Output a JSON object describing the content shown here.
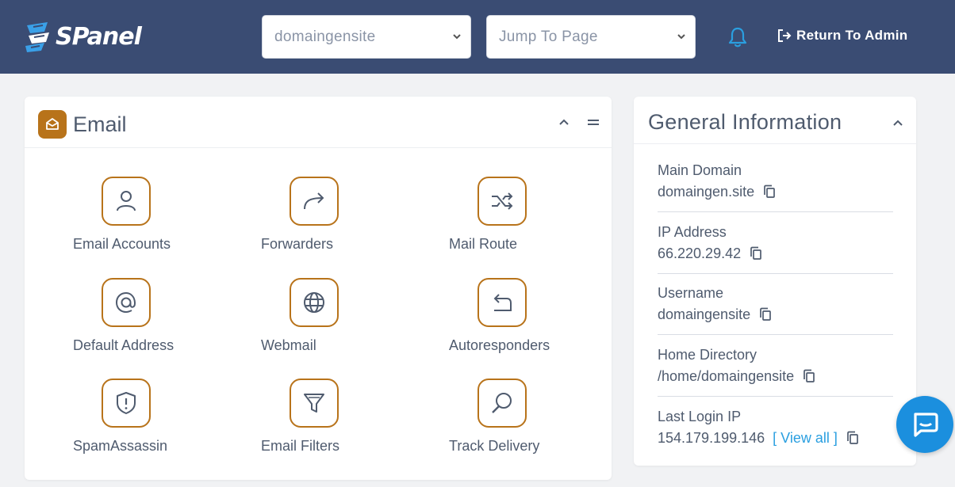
{
  "header": {
    "logo_text": "SPanel",
    "domain_select": "domaingensite",
    "jump_select": "Jump To Page",
    "return_label": "Return To Admin"
  },
  "email": {
    "title": "Email",
    "items": [
      {
        "label": "Email Accounts",
        "icon": "user-icon"
      },
      {
        "label": "Forwarders",
        "icon": "forward-arrow-icon"
      },
      {
        "label": "Mail Route",
        "icon": "shuffle-icon"
      },
      {
        "label": "Default Address",
        "icon": "at-sign-icon"
      },
      {
        "label": "Webmail",
        "icon": "globe-icon"
      },
      {
        "label": "Autoresponders",
        "icon": "reply-arrow-icon"
      },
      {
        "label": "SpamAssassin",
        "icon": "shield-alert-icon"
      },
      {
        "label": "Email Filters",
        "icon": "filter-icon"
      },
      {
        "label": "Track Delivery",
        "icon": "search-icon"
      }
    ]
  },
  "info": {
    "title": "General Information",
    "rows": [
      {
        "label": "Main Domain",
        "value": "domaingen.site"
      },
      {
        "label": "IP Address",
        "value": "66.220.29.42"
      },
      {
        "label": "Username",
        "value": "domaingensite"
      },
      {
        "label": "Home Directory",
        "value": "/home/domaingensite"
      },
      {
        "label": "Last Login IP",
        "value": "154.179.199.146",
        "link": "[ View all ]"
      }
    ]
  },
  "colors": {
    "header_bg": "#3a4c73",
    "accent": "#b8731a",
    "link": "#2a9fe0",
    "chat": "#1b8fde"
  }
}
